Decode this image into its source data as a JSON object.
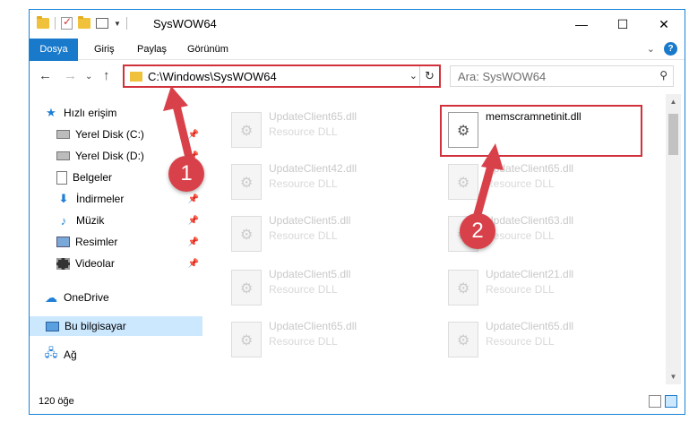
{
  "title": "SysWOW64",
  "ribbon": {
    "tabs": [
      {
        "label": "Dosya"
      },
      {
        "label": "Giriş"
      },
      {
        "label": "Paylaş"
      },
      {
        "label": "Görünüm"
      }
    ],
    "help": "?"
  },
  "nav": {
    "address": "C:\\Windows\\SysWOW64",
    "search_placeholder": "Ara: SysWOW64"
  },
  "sidebar": {
    "items": [
      {
        "label": "Hızlı erişim",
        "icon": "star-icon"
      },
      {
        "label": "Yerel Disk (C:)",
        "icon": "drive-icon"
      },
      {
        "label": "Yerel Disk (D:)",
        "icon": "drive-icon"
      },
      {
        "label": "Belgeler",
        "icon": "document-icon"
      },
      {
        "label": "İndirmeler",
        "icon": "download-icon"
      },
      {
        "label": "Müzik",
        "icon": "music-icon"
      },
      {
        "label": "Resimler",
        "icon": "pictures-icon"
      },
      {
        "label": "Videolar",
        "icon": "videos-icon"
      },
      {
        "label": "OneDrive",
        "icon": "cloud-icon"
      },
      {
        "label": "Bu bilgisayar",
        "icon": "computer-icon"
      },
      {
        "label": "Ağ",
        "icon": "network-icon"
      }
    ]
  },
  "files": [
    {
      "name": "UpdateClient65.dll",
      "desc": "Resource DLL"
    },
    {
      "name": "memscramnetinit.dll",
      "desc": ""
    },
    {
      "name": "UpdateClient42.dll",
      "desc": "Resource DLL"
    },
    {
      "name": "UpdateClient65.dll",
      "desc": "Resource DLL"
    },
    {
      "name": "UpdateClient5.dll",
      "desc": "Resource DLL"
    },
    {
      "name": "UpdateClient63.dll",
      "desc": "Resource DLL"
    },
    {
      "name": "UpdateClient5.dll",
      "desc": "Resource DLL"
    },
    {
      "name": "UpdateClient21.dll",
      "desc": "Resource DLL"
    },
    {
      "name": "UpdateClient65.dll",
      "desc": "Resource DLL"
    },
    {
      "name": "UpdateClient65.dll",
      "desc": "Resource DLL"
    }
  ],
  "status": {
    "count": "120 öğe"
  },
  "annotations": {
    "badge1": "1",
    "badge2": "2"
  },
  "colors": {
    "accent": "#1979ca",
    "highlight": "#d0313a",
    "badge": "#d9414a"
  }
}
